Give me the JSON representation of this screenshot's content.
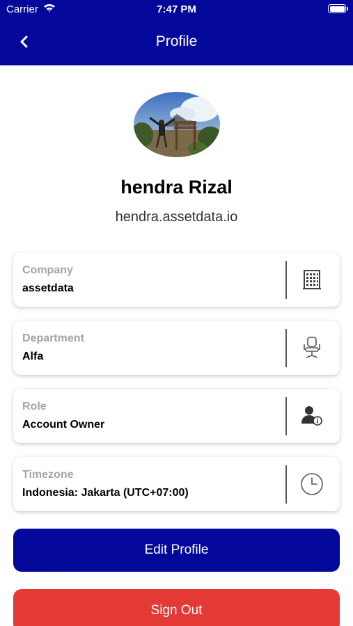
{
  "status_bar": {
    "carrier": "Carrier",
    "time": "7:47 PM"
  },
  "nav": {
    "title": "Profile"
  },
  "user": {
    "name": "hendra Rizal",
    "email": "hendra.assetdata.io"
  },
  "fields": [
    {
      "label": "Company",
      "value": "assetdata",
      "icon": "building-icon"
    },
    {
      "label": "Department",
      "value": "Alfa",
      "icon": "office-chair-icon"
    },
    {
      "label": "Role",
      "value": "Account Owner",
      "icon": "user-info-icon"
    },
    {
      "label": "Timezone",
      "value": "Indonesia: Jakarta (UTC+07:00)",
      "icon": "clock-icon"
    }
  ],
  "buttons": {
    "edit_profile": "Edit Profile",
    "sign_out": "Sign Out"
  },
  "colors": {
    "primary": "#03089a",
    "danger": "#e53935",
    "label": "#a4a4a4"
  }
}
